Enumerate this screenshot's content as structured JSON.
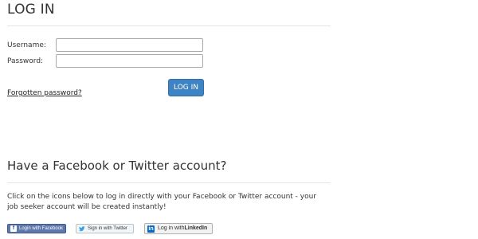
{
  "login": {
    "title": "LOG IN",
    "username_label": "Username:",
    "password_label": "Password:",
    "username_value": "",
    "password_value": "",
    "button_label": "LOG IN",
    "forgotten_link": "Forgotten password?"
  },
  "social": {
    "title": "Have a Facebook or Twitter account?",
    "description": "Click on the icons below to log in directly with your Facebook or Twitter account - your job seeker account will be created instantly!",
    "facebook_button": "Login with Facebook",
    "twitter_button": "Sign in with Twitter",
    "linkedin_button_prefix": "Log in with ",
    "linkedin_button_brand": "LinkedIn"
  },
  "icons": {
    "facebook": "facebook-icon",
    "twitter": "twitter-bird-icon",
    "linkedin": "linkedin-icon"
  },
  "colors": {
    "login_button": "#3e84c4",
    "facebook": "#5f78ab",
    "linkedin": "#0a66c2",
    "twitter_bird": "#3aa0e0"
  }
}
